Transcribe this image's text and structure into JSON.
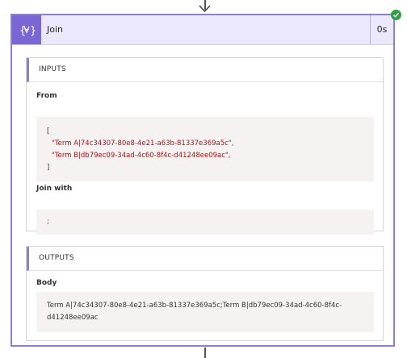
{
  "action": {
    "title": "Join",
    "duration": "0s",
    "status_icon": "check-circle-icon",
    "colors": {
      "accent": "#7a67d4",
      "header_bg": "#ebe8fc",
      "success": "#2e9e48"
    }
  },
  "inputs": {
    "section_title": "INPUTS",
    "from_label": "From",
    "from_open": "[",
    "from_items": [
      "\"Term A|74c34307-80e8-4e21-a63b-81337e369a5c\",",
      "\"Term B|db79ec09-34ad-4c60-8f4c-d41248ee09ac\","
    ],
    "from_close": "]",
    "join_label": "Join with",
    "join_value": ";"
  },
  "outputs": {
    "section_title": "OUTPUTS",
    "body_label": "Body",
    "body_value": "Term A|74c34307-80e8-4e21-a63b-81337e369a5c;Term B|db79ec09-34ad-4c60-8f4c-d41248ee09ac"
  }
}
